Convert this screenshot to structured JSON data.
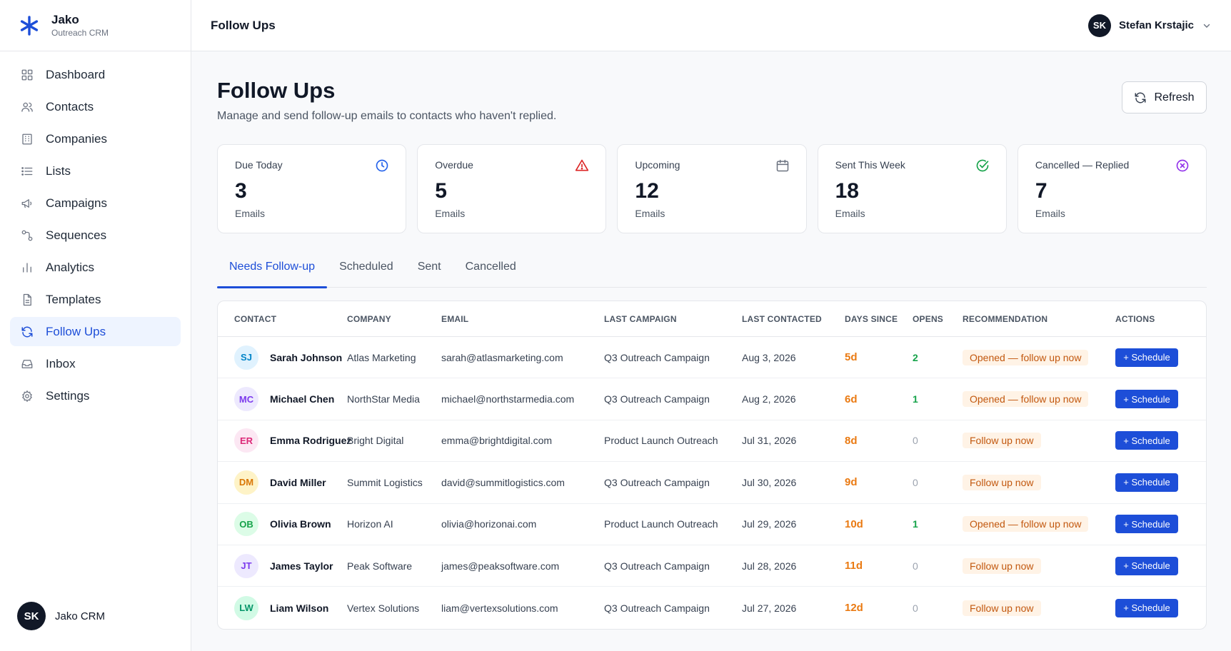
{
  "brand": {
    "name": "Jako",
    "subtitle": "Outreach CRM",
    "accent": "#1d4ed8"
  },
  "sidebar": {
    "items": [
      {
        "label": "Dashboard",
        "icon": "grid-icon"
      },
      {
        "label": "Contacts",
        "icon": "users-icon"
      },
      {
        "label": "Companies",
        "icon": "building-icon"
      },
      {
        "label": "Lists",
        "icon": "list-icon"
      },
      {
        "label": "Campaigns",
        "icon": "megaphone-icon"
      },
      {
        "label": "Sequences",
        "icon": "sequence-icon"
      },
      {
        "label": "Analytics",
        "icon": "bar-chart-icon"
      },
      {
        "label": "Templates",
        "icon": "file-icon"
      },
      {
        "label": "Follow Ups",
        "icon": "refresh-icon",
        "active": true
      },
      {
        "label": "Inbox",
        "icon": "inbox-icon"
      },
      {
        "label": "Settings",
        "icon": "gear-icon"
      }
    ],
    "footer": {
      "initials": "SK",
      "name": "Jako CRM"
    }
  },
  "topbar": {
    "title": "Follow Ups",
    "user": {
      "initials": "SK",
      "name": "Stefan Krstajic"
    }
  },
  "page": {
    "title": "Follow Ups",
    "subtitle": "Manage and send follow-up emails to contacts who haven't replied.",
    "refresh_label": "Refresh"
  },
  "stats": [
    {
      "label": "Due Today",
      "value": "3",
      "unit": "Emails",
      "icon": "clock-icon",
      "color": "#2563eb"
    },
    {
      "label": "Overdue",
      "value": "5",
      "unit": "Emails",
      "icon": "warning-icon",
      "color": "#dc2626"
    },
    {
      "label": "Upcoming",
      "value": "12",
      "unit": "Emails",
      "icon": "calendar-icon",
      "color": "#6b7280"
    },
    {
      "label": "Sent This Week",
      "value": "18",
      "unit": "Emails",
      "icon": "check-circle-icon",
      "color": "#16a34a"
    },
    {
      "label": "Cancelled — Replied",
      "value": "7",
      "unit": "Emails",
      "icon": "x-circle-icon",
      "color": "#9333ea"
    }
  ],
  "tabs": [
    {
      "label": "Needs Follow-up",
      "active": true
    },
    {
      "label": "Scheduled"
    },
    {
      "label": "Sent"
    },
    {
      "label": "Cancelled"
    }
  ],
  "table": {
    "headers": [
      "CONTACT",
      "COMPANY",
      "EMAIL",
      "LAST CAMPAIGN",
      "LAST CONTACTED",
      "DAYS SINCE",
      "OPENS",
      "RECOMMENDATION",
      "ACTIONS"
    ],
    "action_label": "+ Schedule",
    "rows": [
      {
        "initials": "SJ",
        "avatar_bg": "#e0f2fe",
        "avatar_fg": "#0284c7",
        "name": "Sarah Johnson",
        "company": "Atlas Marketing",
        "email": "sarah@atlasmarketing.com",
        "campaign": "Q3 Outreach Campaign",
        "last_contacted": "Aug 3, 2026",
        "days": "5d",
        "opens": "2",
        "recommendation": "Opened — follow up now"
      },
      {
        "initials": "MC",
        "avatar_bg": "#ede9fe",
        "avatar_fg": "#7c3aed",
        "name": "Michael Chen",
        "company": "NorthStar Media",
        "email": "michael@northstarmedia.com",
        "campaign": "Q3 Outreach Campaign",
        "last_contacted": "Aug 2, 2026",
        "days": "6d",
        "opens": "1",
        "recommendation": "Opened — follow up now"
      },
      {
        "initials": "ER",
        "avatar_bg": "#fce7f3",
        "avatar_fg": "#db2777",
        "name": "Emma Rodriguez",
        "company": "Bright Digital",
        "email": "emma@brightdigital.com",
        "campaign": "Product Launch Outreach",
        "last_contacted": "Jul 31, 2026",
        "days": "8d",
        "opens": "0",
        "recommendation": "Follow up now"
      },
      {
        "initials": "DM",
        "avatar_bg": "#fef3c7",
        "avatar_fg": "#d97706",
        "name": "David Miller",
        "company": "Summit Logistics",
        "email": "david@summitlogistics.com",
        "campaign": "Q3 Outreach Campaign",
        "last_contacted": "Jul 30, 2026",
        "days": "9d",
        "opens": "0",
        "recommendation": "Follow up now"
      },
      {
        "initials": "OB",
        "avatar_bg": "#dcfce7",
        "avatar_fg": "#16a34a",
        "name": "Olivia Brown",
        "company": "Horizon AI",
        "email": "olivia@horizonai.com",
        "campaign": "Product Launch Outreach",
        "last_contacted": "Jul 29, 2026",
        "days": "10d",
        "opens": "1",
        "recommendation": "Opened — follow up now"
      },
      {
        "initials": "JT",
        "avatar_bg": "#ede9fe",
        "avatar_fg": "#7c3aed",
        "name": "James Taylor",
        "company": "Peak Software",
        "email": "james@peaksoftware.com",
        "campaign": "Q3 Outreach Campaign",
        "last_contacted": "Jul 28, 2026",
        "days": "11d",
        "opens": "0",
        "recommendation": "Follow up now"
      },
      {
        "initials": "LW",
        "avatar_bg": "#d1fae5",
        "avatar_fg": "#059669",
        "name": "Liam Wilson",
        "company": "Vertex Solutions",
        "email": "liam@vertexsolutions.com",
        "campaign": "Q3 Outreach Campaign",
        "last_contacted": "Jul 27, 2026",
        "days": "12d",
        "opens": "0",
        "recommendation": "Follow up now"
      }
    ]
  }
}
